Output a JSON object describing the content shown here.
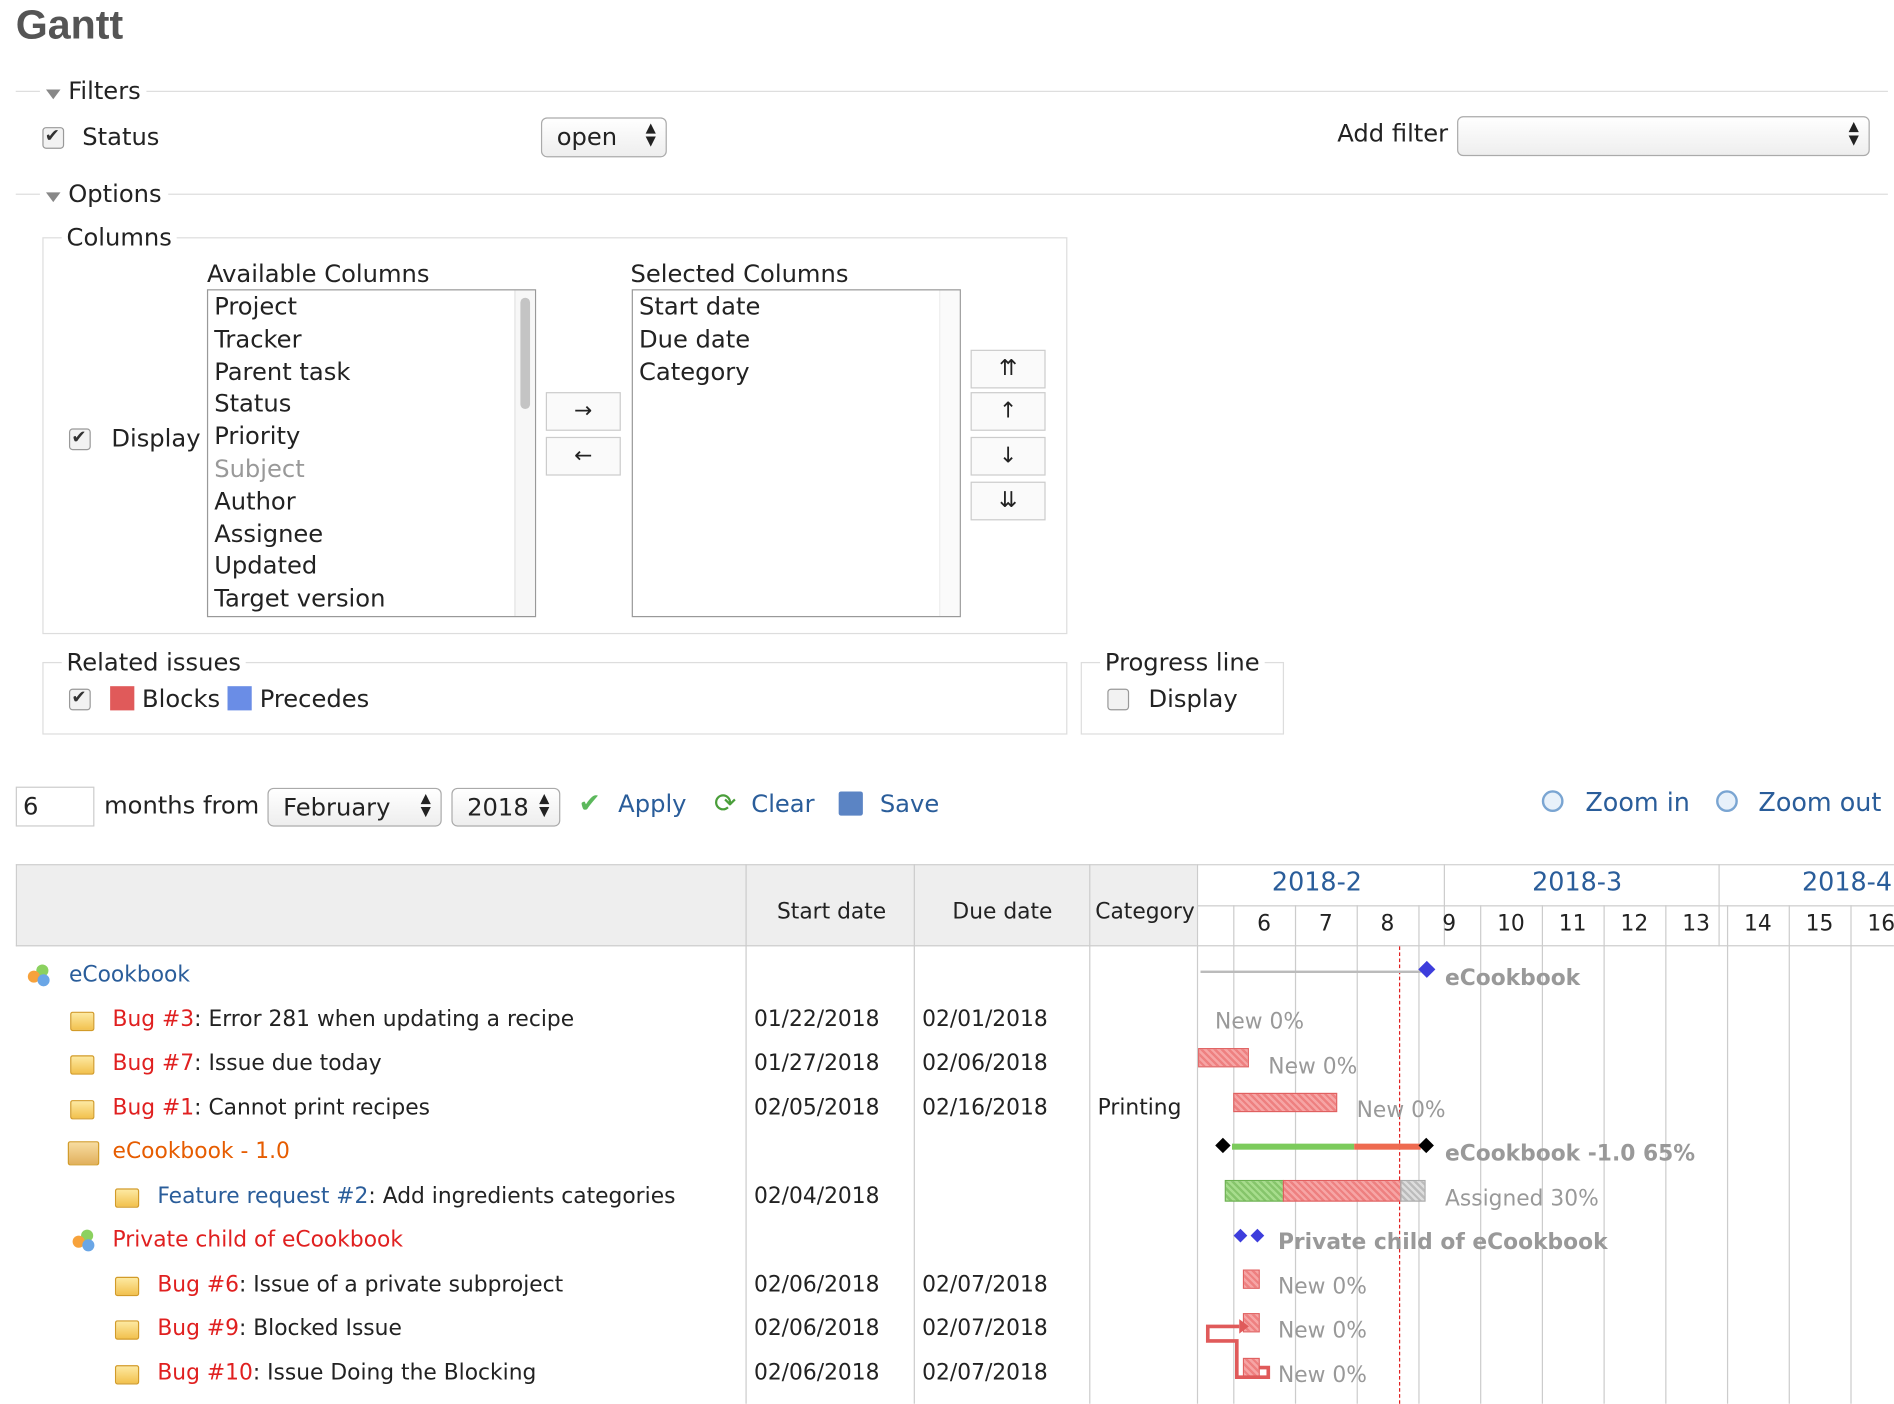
{
  "page": {
    "title": "Gantt"
  },
  "filters": {
    "legend": "Filters",
    "status_label": "Status",
    "status_value": "open",
    "add_filter_label": "Add filter",
    "add_filter_value": ""
  },
  "options": {
    "legend": "Options",
    "columns_legend": "Columns",
    "display_label": "Display",
    "available_label": "Available Columns",
    "available": [
      "Project",
      "Tracker",
      "Parent task",
      "Status",
      "Priority",
      "Subject",
      "Author",
      "Assignee",
      "Updated",
      "Target version"
    ],
    "selected_label": "Selected Columns",
    "selected": [
      "Start date",
      "Due date",
      "Category"
    ],
    "move_right": "→",
    "move_left": "←",
    "move_top": "⇈",
    "move_up": "↑",
    "move_down": "↓",
    "move_bottom": "⇊"
  },
  "related": {
    "legend": "Related issues",
    "blocks": "Blocks",
    "precedes": "Precedes",
    "blocks_color": "#e05a5a",
    "precedes_color": "#6a8de6"
  },
  "progress": {
    "legend": "Progress line",
    "display": "Display"
  },
  "toolbar": {
    "months": "6",
    "months_from": "months from",
    "month": "February",
    "year": "2018",
    "apply": "Apply",
    "clear": "Clear",
    "save": "Save",
    "zoom_in": "Zoom in",
    "zoom_out": "Zoom out"
  },
  "table": {
    "headers": {
      "start": "Start date",
      "due": "Due date",
      "category": "Category"
    },
    "months": [
      "2018-2",
      "2018-3",
      "2018-4"
    ],
    "weeks": [
      "6",
      "7",
      "8",
      "9",
      "10",
      "11",
      "12",
      "13",
      "14",
      "15",
      "16"
    ],
    "rows": [
      {
        "type": "project",
        "prefix": "",
        "num": "",
        "title": "eCookbook",
        "start": "",
        "due": "",
        "category": "",
        "bar_label": "eCookbook"
      },
      {
        "type": "issue",
        "prefix": "Bug ",
        "num": "#3",
        "title": ": Error 281 when updating a recipe",
        "start": "01/22/2018",
        "due": "02/01/2018",
        "category": "",
        "bar_label": "New 0%"
      },
      {
        "type": "issue",
        "prefix": "Bug ",
        "num": "#7",
        "title": ": Issue due today",
        "start": "01/27/2018",
        "due": "02/06/2018",
        "category": "",
        "bar_label": "New 0%"
      },
      {
        "type": "issue",
        "prefix": "Bug ",
        "num": "#1",
        "title": ": Cannot print recipes",
        "start": "02/05/2018",
        "due": "02/16/2018",
        "category": "Printing",
        "bar_label": "New 0%"
      },
      {
        "type": "version",
        "prefix": "",
        "num": "",
        "title": "eCookbook - 1.0",
        "start": "",
        "due": "",
        "category": "",
        "bar_label": "eCookbook -1.0 65%"
      },
      {
        "type": "issue",
        "prefix": "Feature request ",
        "num": "#2",
        "title": ": Add ingredients categories",
        "start": "02/04/2018",
        "due": "",
        "category": "",
        "bar_label": "Assigned 30%"
      },
      {
        "type": "project",
        "prefix": "",
        "num": "",
        "title": "Private child of eCookbook",
        "start": "",
        "due": "",
        "category": "",
        "bar_label": "Private child of eCookbook"
      },
      {
        "type": "issue",
        "prefix": "Bug ",
        "num": "#6",
        "title": ": Issue of a private subproject",
        "start": "02/06/2018",
        "due": "02/07/2018",
        "category": "",
        "bar_label": "New 0%"
      },
      {
        "type": "issue",
        "prefix": "Bug ",
        "num": "#9",
        "title": ": Blocked Issue",
        "start": "02/06/2018",
        "due": "02/07/2018",
        "category": "",
        "bar_label": "New 0%"
      },
      {
        "type": "issue",
        "prefix": "Bug ",
        "num": "#10",
        "title": ": Issue Doing the Blocking",
        "start": "02/06/2018",
        "due": "02/07/2018",
        "category": "",
        "bar_label": "New 0%"
      }
    ]
  }
}
